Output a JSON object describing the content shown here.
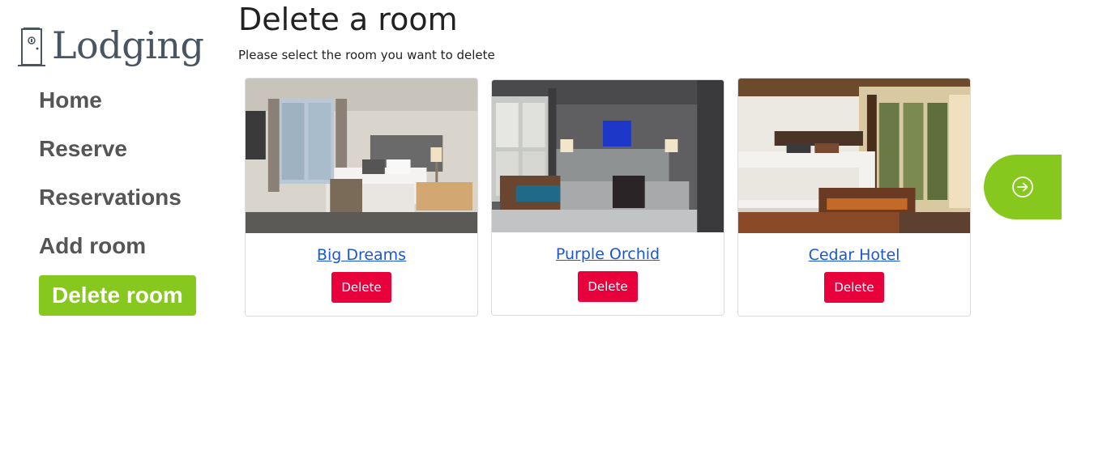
{
  "brand": {
    "name": "Lodging",
    "icon": "door-icon"
  },
  "nav": {
    "items": [
      {
        "label": "Home"
      },
      {
        "label": "Reserve"
      },
      {
        "label": "Reservations"
      },
      {
        "label": "Add room"
      },
      {
        "label": "Delete room",
        "active": true
      }
    ]
  },
  "main": {
    "title": "Delete a room",
    "subtitle": "Please select the room you want to delete",
    "rooms": [
      {
        "name": "Big Dreams",
        "action_label": "Delete"
      },
      {
        "name": "Purple Orchid",
        "action_label": "Delete"
      },
      {
        "name": "Cedar Hotel",
        "action_label": "Delete"
      }
    ],
    "next_icon": "arrow-right-circle-icon"
  },
  "colors": {
    "accent": "#86c81e",
    "danger": "#e8003d",
    "link": "#1a56db"
  }
}
